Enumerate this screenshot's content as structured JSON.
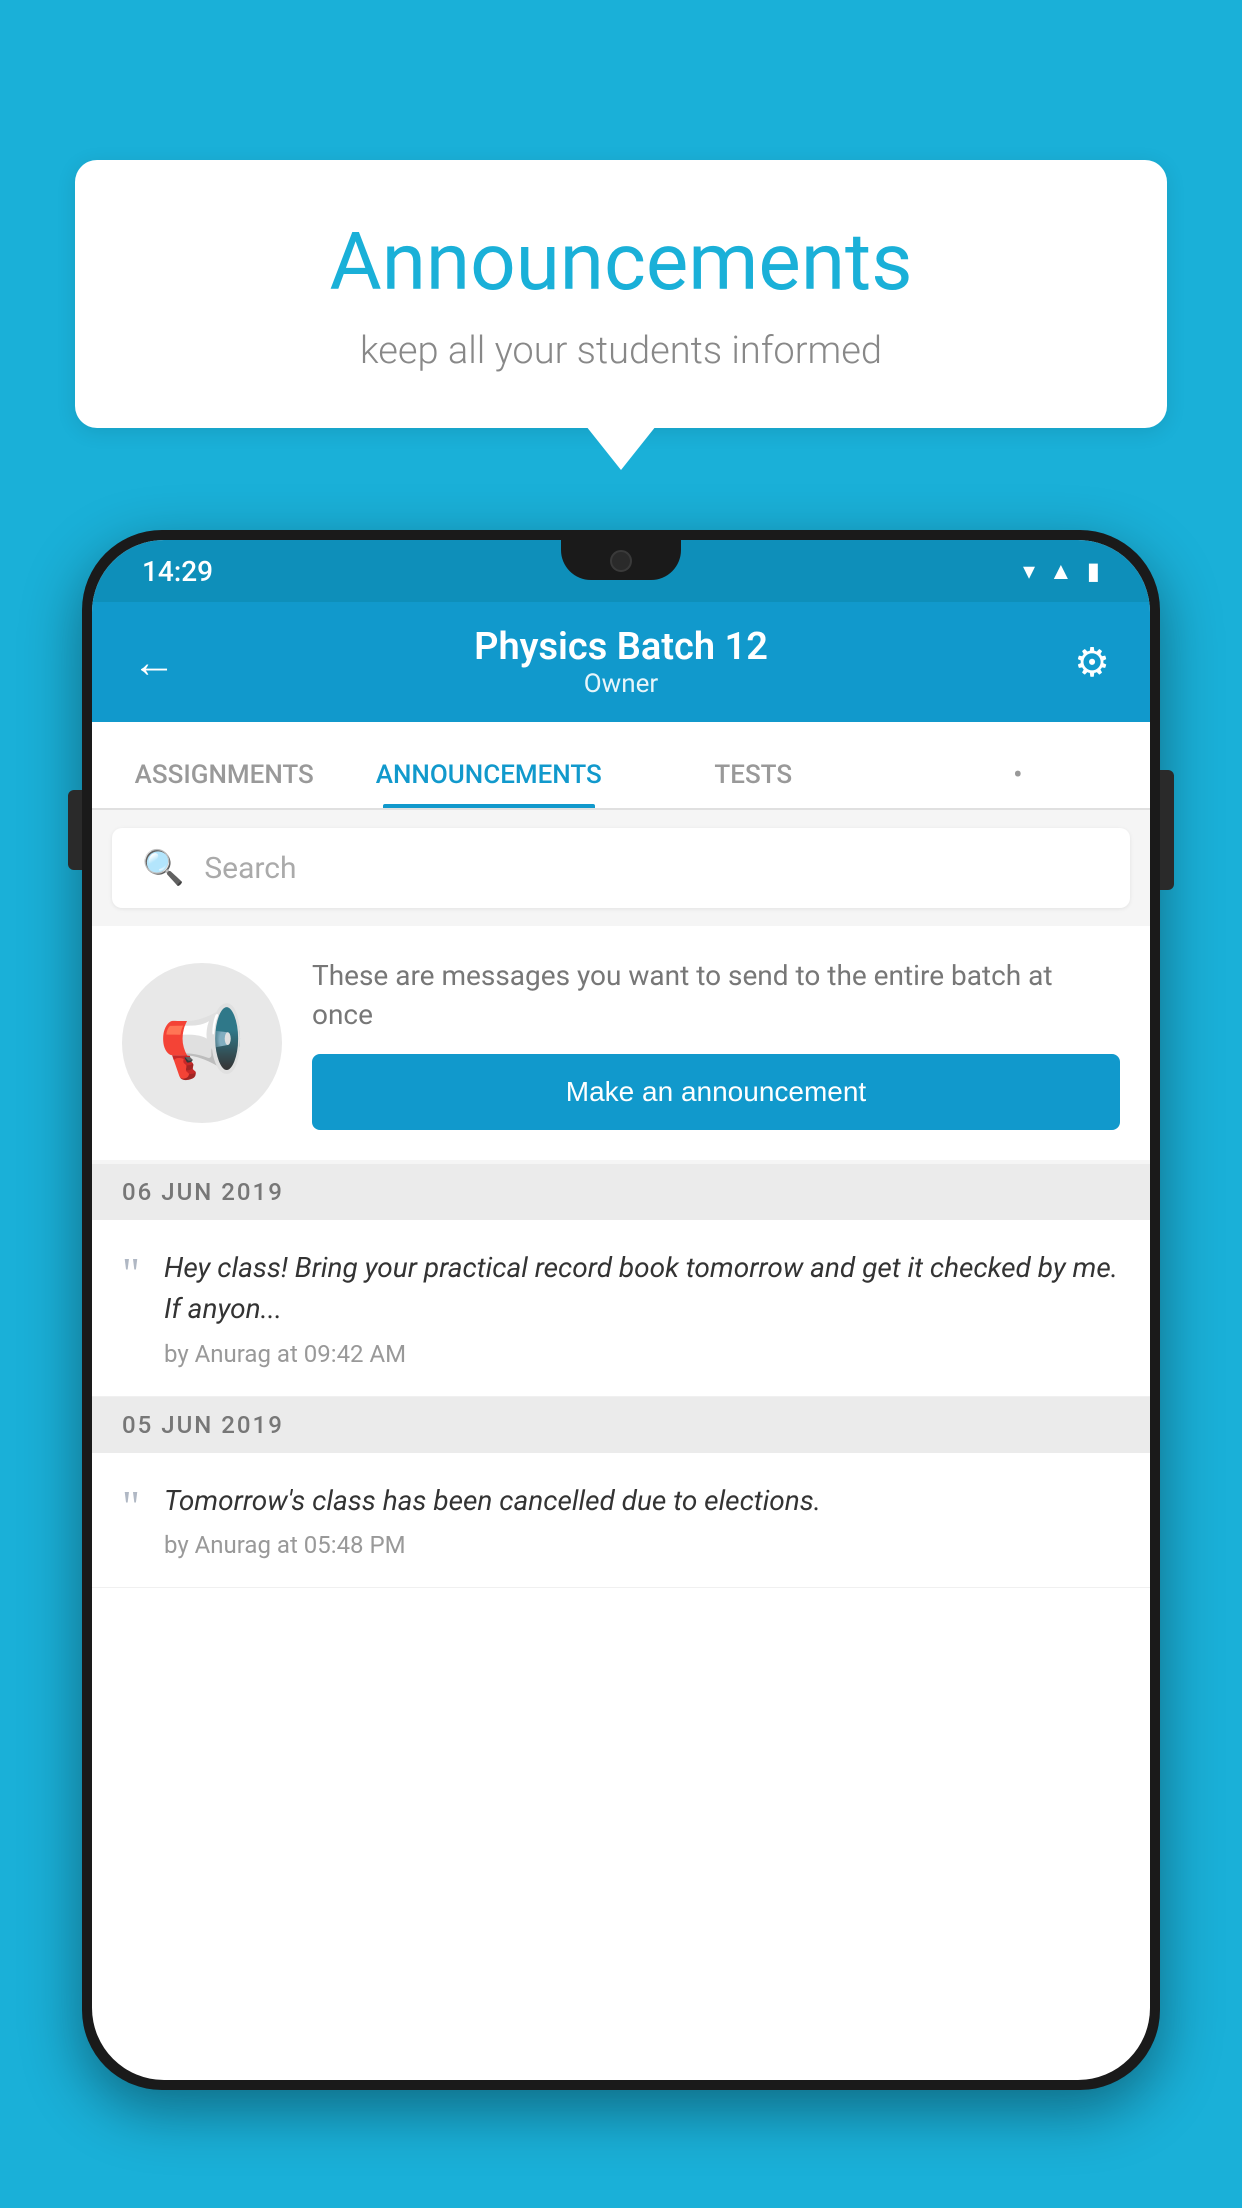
{
  "background": {
    "color": "#1ab0d8"
  },
  "speech_bubble": {
    "title": "Announcements",
    "subtitle": "keep all your students informed"
  },
  "phone": {
    "status_bar": {
      "time": "14:29"
    },
    "header": {
      "title": "Physics Batch 12",
      "subtitle": "Owner",
      "back_label": "←",
      "settings_label": "⚙"
    },
    "tabs": [
      {
        "label": "ASSIGNMENTS",
        "active": false
      },
      {
        "label": "ANNOUNCEMENTS",
        "active": true
      },
      {
        "label": "TESTS",
        "active": false
      },
      {
        "label": "•",
        "active": false
      }
    ],
    "search": {
      "placeholder": "Search"
    },
    "promo": {
      "description": "These are messages you want to send to the entire batch at once",
      "button_label": "Make an announcement"
    },
    "date_sections": [
      {
        "date": "06  JUN  2019",
        "announcements": [
          {
            "text": "Hey class! Bring your practical record book tomorrow and get it checked by me. If anyon...",
            "meta": "by Anurag at 09:42 AM"
          }
        ]
      },
      {
        "date": "05  JUN  2019",
        "announcements": [
          {
            "text": "Tomorrow's class has been cancelled due to elections.",
            "meta": "by Anurag at 05:48 PM"
          }
        ]
      }
    ]
  }
}
